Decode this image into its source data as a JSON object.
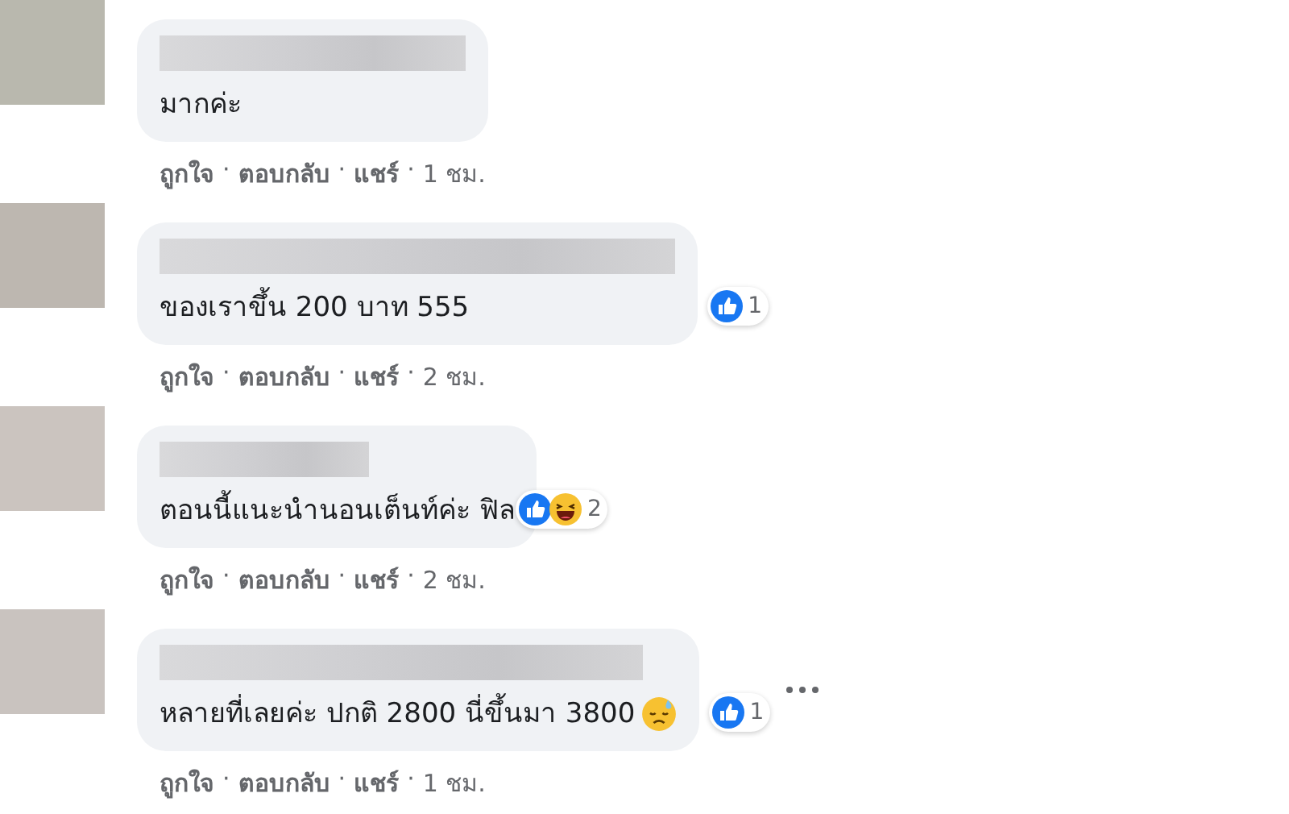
{
  "separator": "·",
  "comments": [
    {
      "text": "มากค่ะ",
      "actions": [
        "ถูกใจ",
        "ตอบกลับ",
        "แชร์"
      ],
      "time": "1 ชม.",
      "more": false
    },
    {
      "text": "ของเราขึ้น 200 บาท 555",
      "actions": [
        "ถูกใจ",
        "ตอบกลับ",
        "แชร์"
      ],
      "time": "2 ชม.",
      "reactions": [
        {
          "kind": "like"
        }
      ],
      "reaction_count": "1",
      "more": false
    },
    {
      "text": "ตอนนี้แนะนำนอนเต็นท์ค่ะ ฟิล",
      "actions": [
        "ถูกใจ",
        "ตอบกลับ",
        "แชร์"
      ],
      "time": "2 ชม.",
      "reactions": [
        {
          "kind": "like"
        },
        {
          "kind": "haha"
        }
      ],
      "reaction_count": "2",
      "more": false
    },
    {
      "text": "หลายที่เลยค่ะ ปกติ 2800 นี่ขึ้นมา 3800",
      "emoji": {
        "kind": "sweat"
      },
      "actions": [
        "ถูกใจ",
        "ตอบกลับ",
        "แชร์"
      ],
      "time": "1 ชม.",
      "reactions": [
        {
          "kind": "like"
        }
      ],
      "reaction_count": "1",
      "more": true
    }
  ]
}
